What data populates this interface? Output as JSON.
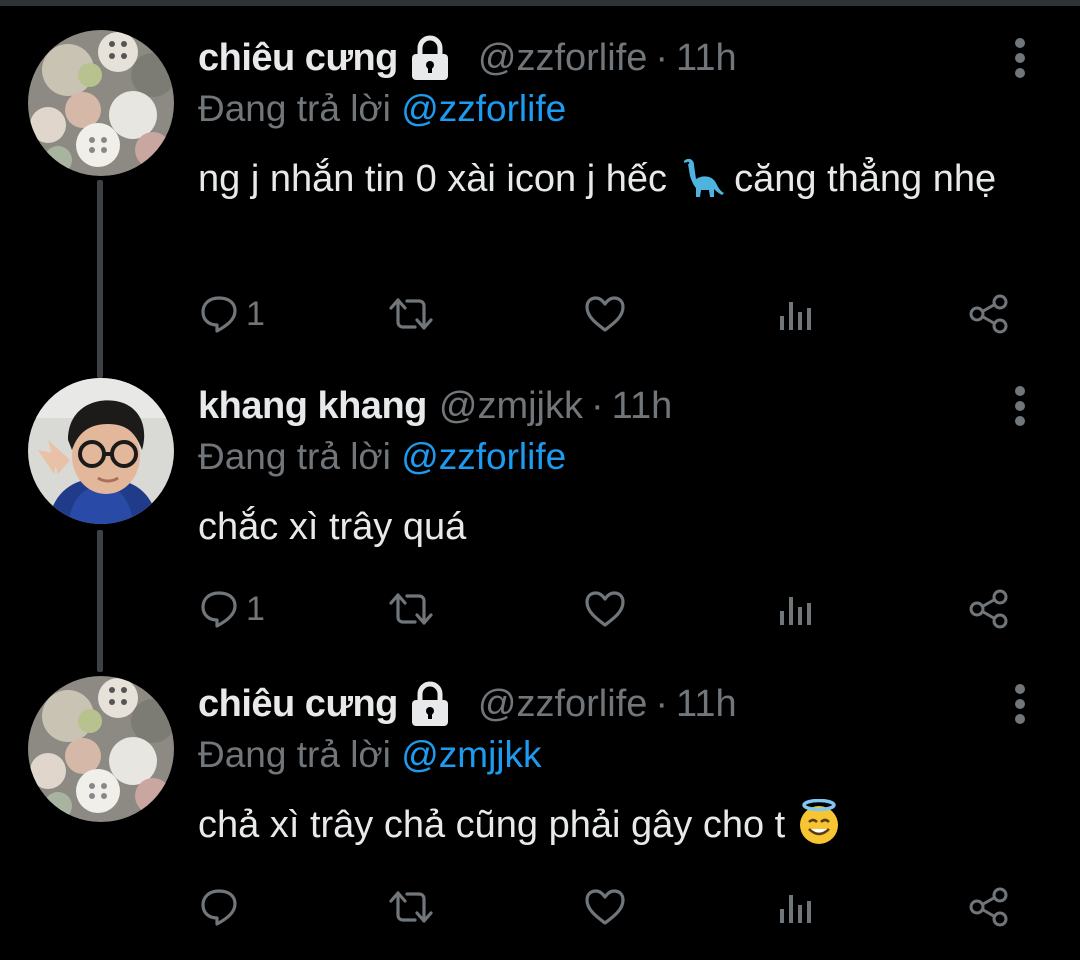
{
  "theme": {
    "background": "#000000",
    "text": "#e7e9ea",
    "muted": "#71767b",
    "accent": "#1d9bf0",
    "thread_line": "#3e4144"
  },
  "tweets": [
    {
      "name": "chiêu cưng",
      "protected": true,
      "handle": "@zzforlife",
      "separator": "·",
      "time": "11h",
      "replying_prefix": "Đang trả lời",
      "replying_to": "@zzforlife",
      "text_before_emoji": "ng j nhắn tin 0 xài icon j hếc ",
      "emoji": "sauropod-emoji",
      "text_after_emoji": " căng thẳng nhẹ",
      "reply_count": "1",
      "retweet_count": "",
      "like_count": "",
      "avatar": "buttons-photo-avatar",
      "icons": [
        "reply-icon",
        "retweet-icon",
        "like-icon",
        "analytics-icon",
        "share-icon",
        "more-icon"
      ]
    },
    {
      "name": "khang khang",
      "protected": false,
      "handle": "@zmjjkk",
      "separator": "·",
      "time": "11h",
      "replying_prefix": "Đang trả lời",
      "replying_to": "@zzforlife",
      "text_before_emoji": "chắc xì trây quá",
      "emoji": "",
      "text_after_emoji": "",
      "reply_count": "1",
      "retweet_count": "",
      "like_count": "",
      "avatar": "person-photo-avatar",
      "icons": [
        "reply-icon",
        "retweet-icon",
        "like-icon",
        "analytics-icon",
        "share-icon",
        "more-icon"
      ]
    },
    {
      "name": "chiêu cưng",
      "protected": true,
      "handle": "@zzforlife",
      "separator": "·",
      "time": "11h",
      "replying_prefix": "Đang trả lời",
      "replying_to": "@zmjjkk",
      "text_before_emoji": "chả xì trây chả cũng phải gây cho t ",
      "emoji": "smiling-face-with-halo-emoji",
      "text_after_emoji": "",
      "reply_count": "",
      "retweet_count": "",
      "like_count": "",
      "avatar": "buttons-photo-avatar",
      "icons": [
        "reply-icon",
        "retweet-icon",
        "like-icon",
        "analytics-icon",
        "share-icon",
        "more-icon"
      ]
    }
  ]
}
